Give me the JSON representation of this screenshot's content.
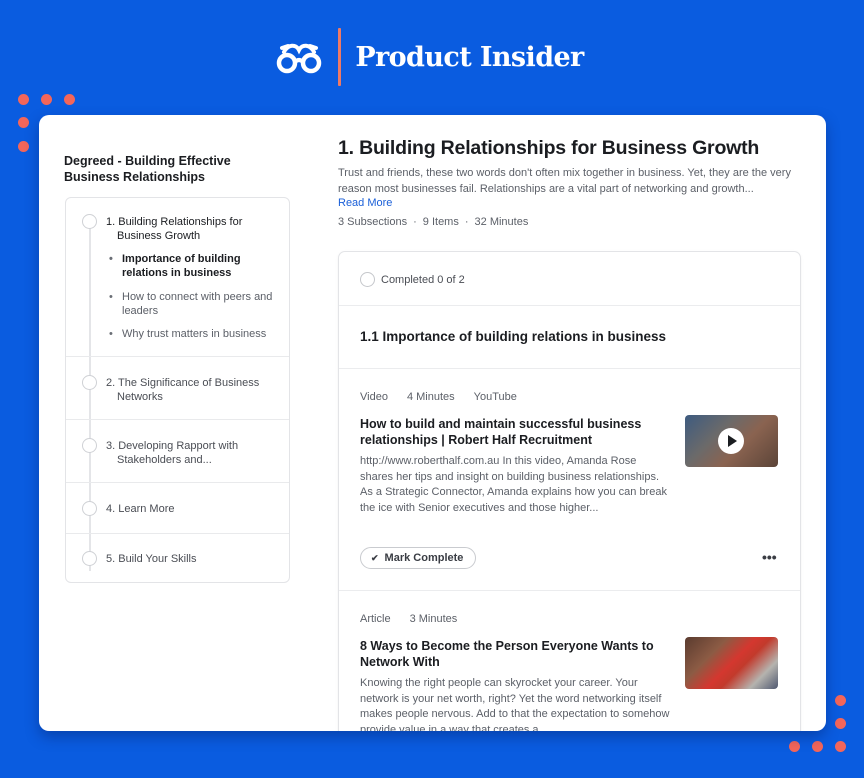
{
  "brand": {
    "logo_icon": "glasses-icon",
    "name": "Product Insider",
    "accent_color": "#ef7a65",
    "background_color": "#0a5ce0"
  },
  "sidebar": {
    "course_title": "Degreed - Building Effective Business Relationships",
    "sections": [
      {
        "label": "1. Building Relationships for Business Growth",
        "active": true,
        "subsections": [
          {
            "label": "Importance of building relations in business",
            "active": true
          },
          {
            "label": "How to connect with peers and leaders",
            "active": false
          },
          {
            "label": "Why trust matters in business",
            "active": false
          }
        ]
      },
      {
        "label": "2. The Significance of Business Networks",
        "active": false
      },
      {
        "label": "3. Developing Rapport with Stakeholders and...",
        "active": false
      },
      {
        "label": "4. Learn More",
        "active": false
      },
      {
        "label": "5. Build Your Skills",
        "active": false
      }
    ]
  },
  "main": {
    "title": "1.  Building Relationships for Business Growth",
    "description": "Trust and friends, these two words don't often mix together in business. Yet, they are the very reason most businesses fail. Relationships are a vital part of networking and growth...",
    "read_more": "Read More",
    "meta": {
      "subsections": "3 Subsections",
      "items": "9 Items",
      "minutes": "32 Minutes",
      "separator": "·"
    },
    "progress": {
      "label": "Completed 0 of 2",
      "completed": 0,
      "total": 2
    },
    "subsection_title": "1.1  Importance of building relations in business",
    "items": [
      {
        "type": "Video",
        "duration": "4 Minutes",
        "source": "YouTube",
        "title": "How to build and maintain successful business relationships | Robert Half Recruitment",
        "description": "http://www.roberthalf.com.au In this video, Amanda Rose shares her tips and insight on building business relationships. As a Strategic Connector, Amanda explains how you can break the ice with Senior executives and those higher...",
        "thumbnail": "video-thumbnail",
        "action_label": "Mark Complete",
        "more_icon": "more-horizontal-icon"
      },
      {
        "type": "Article",
        "duration": "3 Minutes",
        "title": "8 Ways to Become the Person Everyone Wants to Network With",
        "description": "Knowing the right people can skyrocket your career. Your network is your net worth, right? Yet the word networking itself makes people nervous. Add to that the expectation to somehow provide value in a way that creates a...",
        "thumbnail": "article-thumbnail"
      }
    ]
  }
}
